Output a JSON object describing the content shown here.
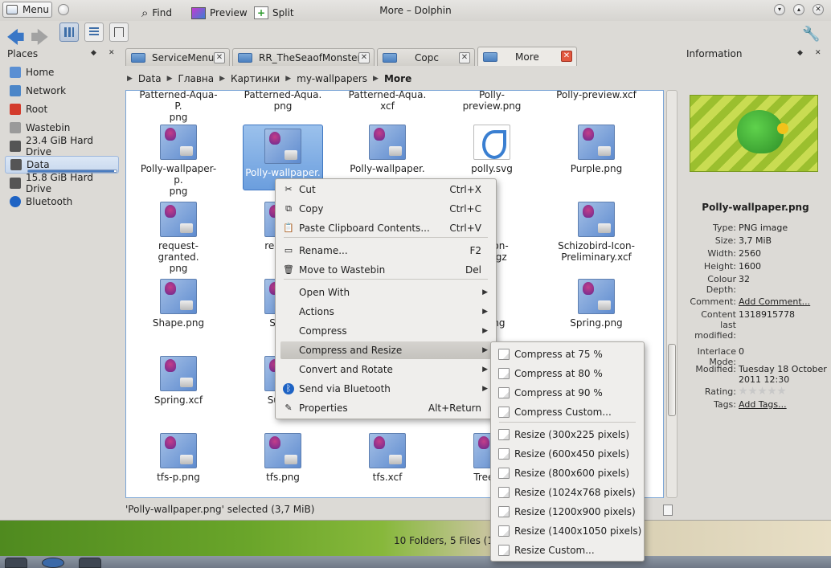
{
  "window": {
    "title": "More – Dolphin",
    "menu_label": "Menu"
  },
  "toolbar": {
    "find": "Find",
    "preview": "Preview",
    "split": "Split"
  },
  "places": {
    "title": "Places",
    "items": [
      {
        "label": "Home",
        "icon": "home-icon",
        "color": "#5a8fd3"
      },
      {
        "label": "Network",
        "icon": "network-icon",
        "color": "#4c86c8"
      },
      {
        "label": "Root",
        "icon": "root-icon",
        "color": "#d33b2c"
      },
      {
        "label": "Wastebin",
        "icon": "wastebin-icon",
        "color": "#9a9a9a"
      },
      {
        "label": "23.4 GiB Hard Drive",
        "icon": "hard-drive-icon",
        "color": "#555"
      },
      {
        "label": "Data",
        "icon": "hard-drive-icon",
        "color": "#555"
      },
      {
        "label": "15.8 GiB Hard Drive",
        "icon": "hard-drive-icon",
        "color": "#555"
      },
      {
        "label": "Bluetooth",
        "icon": "bluetooth-icon",
        "color": "#1e63c4"
      }
    ],
    "data_usage_fraction": 0.97
  },
  "tabs": [
    {
      "label": "ServiceMenus"
    },
    {
      "label": "RR_TheSeaofMonster"
    },
    {
      "label": "Copc"
    },
    {
      "label": "More"
    }
  ],
  "breadcrumb": [
    "Data",
    "Главна",
    "Картинки",
    "my-wallpapers",
    "More"
  ],
  "files": {
    "row0": [
      "Patterned-Aqua-P.\npng",
      "Patterned-Aqua.\npng",
      "Patterned-Aqua.\nxcf",
      "Polly-preview.png",
      "Polly-preview.xcf"
    ],
    "row1": [
      "Polly-wallpaper-p.\npng",
      "Polly-wallpaper.",
      "Polly-wallpaper.",
      "polly.svg",
      "Purple.png"
    ],
    "row2": [
      "request-granted.\npng",
      "request",
      "d-Icon-\n.tar.gz",
      "Schizobird-Icon-\nPreliminary.xcf"
    ],
    "row3": [
      "Shape.png",
      "Simpl",
      "?.png",
      "Spring.png"
    ],
    "row4": [
      "Spring.xcf",
      "Summ"
    ],
    "row5": [
      "tfs-p.png",
      "tfs.png",
      "tfs.xcf",
      "Trees-G"
    ]
  },
  "status": {
    "selection": "'Polly-wallpaper.png' selected (3,7 MiB)",
    "summary": "10 Folders, 5 Files (1,2"
  },
  "information": {
    "title": "Information",
    "file_name": "Polly-wallpaper.png",
    "rows": [
      {
        "k": "Type:",
        "v": "PNG image"
      },
      {
        "k": "Size:",
        "v": "3,7 MiB"
      },
      {
        "k": "Width:",
        "v": "2560"
      },
      {
        "k": "Height:",
        "v": "1600"
      },
      {
        "k": "Colour\nDepth:",
        "v": "32"
      },
      {
        "k": "Comment:",
        "v": "Add Comment..."
      },
      {
        "k": "Content\nlast\nmodified:",
        "v": "1318915778"
      },
      {
        "k": "Interlace\nMode:",
        "v": "0"
      },
      {
        "k": "Modified:",
        "v": "Tuesday 18 October\n2011 12:30"
      },
      {
        "k": "Rating:",
        "v": ""
      },
      {
        "k": "Tags:",
        "v": "Add Tags..."
      }
    ],
    "rating": 0
  },
  "context_menu": {
    "items": [
      {
        "label": "Cut",
        "shortcut": "Ctrl+X",
        "icon": "scissors-icon"
      },
      {
        "label": "Copy",
        "shortcut": "Ctrl+C",
        "icon": "copy-icon"
      },
      {
        "label": "Paste Clipboard Contents...",
        "shortcut": "Ctrl+V",
        "icon": "paste-icon"
      },
      {
        "label": "Rename...",
        "shortcut": "F2",
        "icon": "rename-icon"
      },
      {
        "label": "Move to Wastebin",
        "shortcut": "Del",
        "icon": "wastebin-icon"
      },
      {
        "label": "Open With",
        "shortcut": "",
        "icon": ""
      },
      {
        "label": "Actions",
        "shortcut": "",
        "icon": ""
      },
      {
        "label": "Compress",
        "shortcut": "",
        "icon": ""
      },
      {
        "label": "Compress and Resize",
        "shortcut": "",
        "icon": ""
      },
      {
        "label": "Convert and Rotate",
        "shortcut": "",
        "icon": ""
      },
      {
        "label": "Send via Bluetooth",
        "shortcut": "",
        "icon": "bluetooth-icon"
      },
      {
        "label": "Properties",
        "shortcut": "Alt+Return",
        "icon": "properties-icon"
      }
    ]
  },
  "submenu": {
    "items": [
      "Compress at 75 %",
      "Compress at 80 %",
      "Compress at 90 %",
      "Compress Custom...",
      "Resize (300x225 pixels)",
      "Resize (600x450 pixels)",
      "Resize (800x600 pixels)",
      "Resize (1024x768 pixels)",
      "Resize (1200x900 pixels)",
      "Resize (1400x1050 pixels)",
      "Resize Custom..."
    ]
  },
  "colors": {
    "selection": "#6b9ede",
    "accent": "#3f77c2",
    "link": "#2a5ab4"
  }
}
